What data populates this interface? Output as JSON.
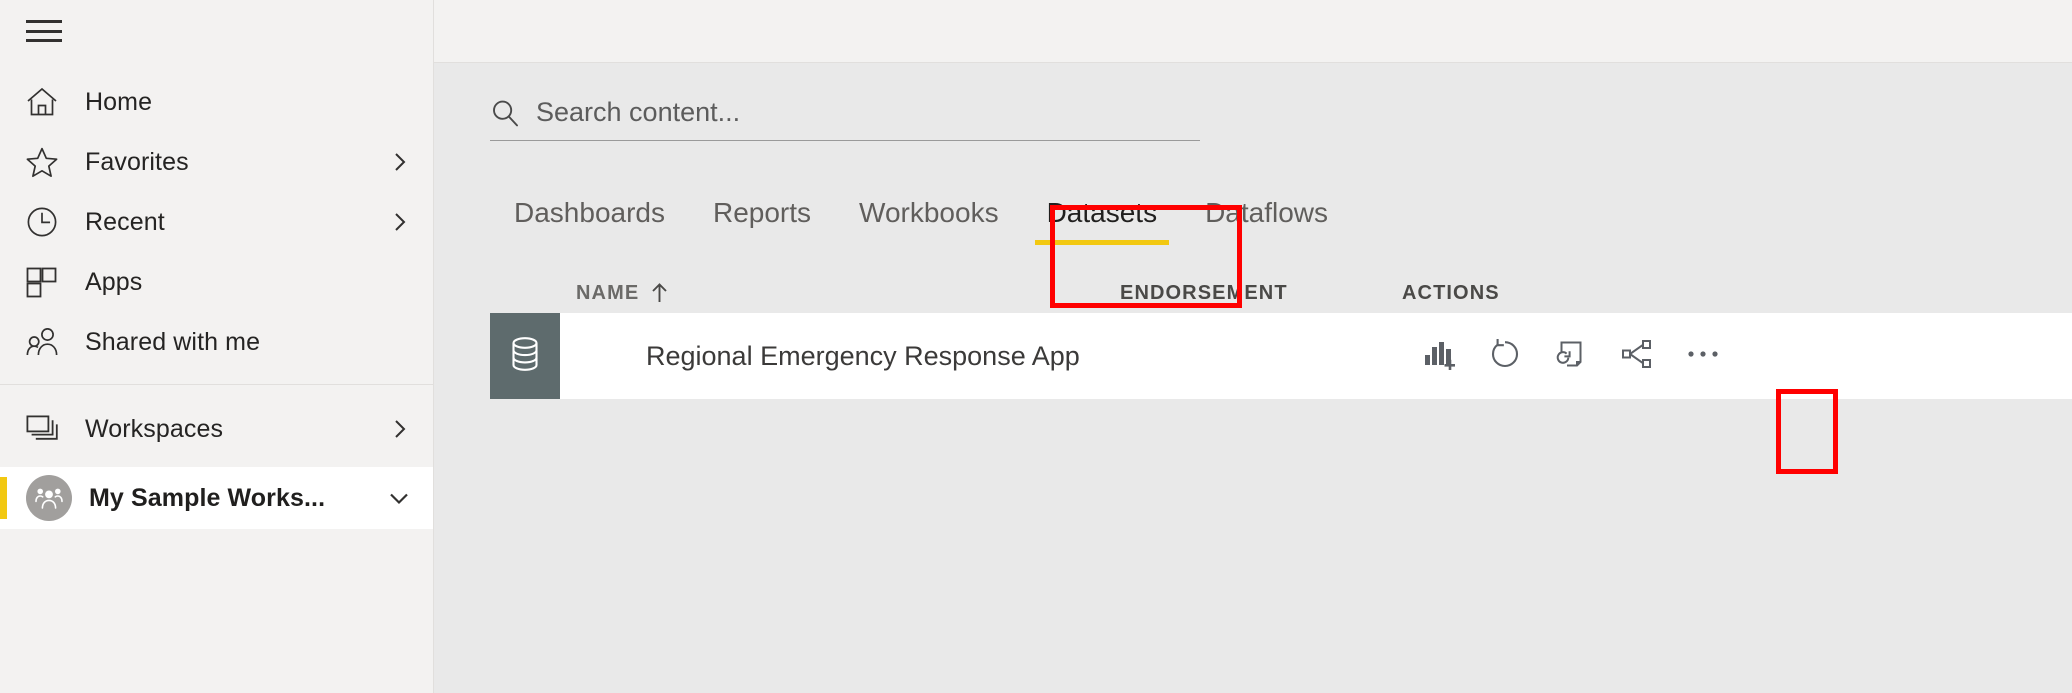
{
  "sidebar": {
    "menu_button": "menu-toggle",
    "items": [
      {
        "label": "Home",
        "icon": "home-icon",
        "has_chevron": false
      },
      {
        "label": "Favorites",
        "icon": "star-icon",
        "has_chevron": true
      },
      {
        "label": "Recent",
        "icon": "clock-icon",
        "has_chevron": true
      },
      {
        "label": "Apps",
        "icon": "apps-grid-icon",
        "has_chevron": false
      },
      {
        "label": "Shared with me",
        "icon": "people-icon",
        "has_chevron": false
      }
    ],
    "lower_items": [
      {
        "label": "Workspaces",
        "icon": "layers-icon",
        "has_chevron": true
      }
    ],
    "selected_workspace": {
      "label": "My Sample Works...",
      "avatar_icon": "group-avatar-icon",
      "chevron": "chevron-down-icon",
      "accent_color": "#f2c811"
    }
  },
  "search": {
    "placeholder": "Search content...",
    "value": "",
    "icon": "search-icon"
  },
  "tabs": [
    {
      "label": "Dashboards",
      "active": false
    },
    {
      "label": "Reports",
      "active": false
    },
    {
      "label": "Workbooks",
      "active": false
    },
    {
      "label": "Datasets",
      "active": true
    },
    {
      "label": "Dataflows",
      "active": false
    }
  ],
  "table": {
    "columns": {
      "name": "NAME",
      "name_sort": "ascending",
      "endorsement": "ENDORSEMENT",
      "actions": "ACTIONS"
    },
    "rows": [
      {
        "name": "Regional Emergency Response App",
        "type_icon": "database-icon",
        "tile_color": "#5e6b6d",
        "endorsement": "",
        "actions": [
          {
            "name": "create-report-icon",
            "title": "Create report"
          },
          {
            "name": "refresh-now-icon",
            "title": "Refresh now"
          },
          {
            "name": "schedule-refresh-icon",
            "title": "Schedule refresh"
          },
          {
            "name": "share-icon",
            "title": "Share"
          },
          {
            "name": "more-options-icon",
            "title": "More options"
          }
        ]
      }
    ]
  },
  "annotations": {
    "highlight_color": "#ff0000",
    "boxes": [
      {
        "target": "tab-datasets",
        "label": "Datasets tab highlight"
      },
      {
        "target": "action-schedule-refresh",
        "label": "Schedule refresh action highlight"
      }
    ]
  }
}
